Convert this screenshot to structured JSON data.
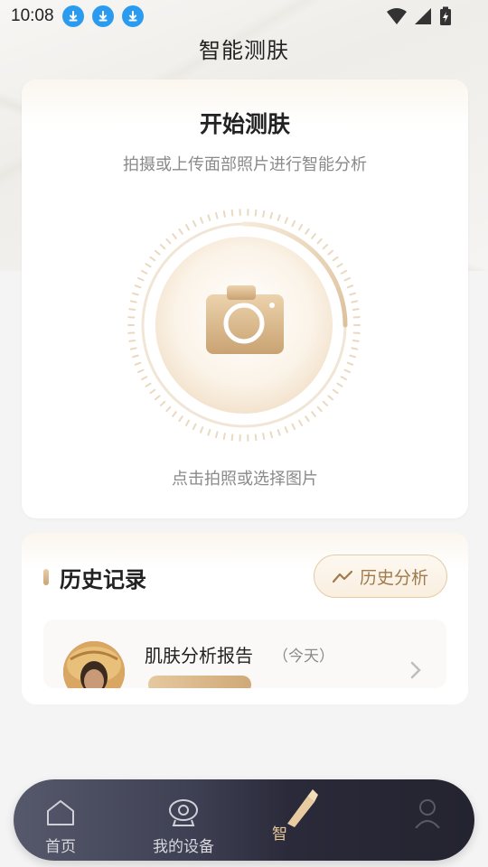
{
  "status_bar": {
    "time": "10:08",
    "download_icon_count": 3,
    "icons": [
      "download-icon",
      "download-icon",
      "download-icon",
      "wifi-icon",
      "cellular-signal-icon",
      "battery-charging-icon"
    ]
  },
  "header": {
    "title": "智能测肤"
  },
  "scan_card": {
    "heading": "开始测肤",
    "subtitle": "拍摄或上传面部照片进行智能分析",
    "camera_icon": "camera-icon",
    "hint": "点击拍照或选择图片"
  },
  "history": {
    "title": "历史记录",
    "analysis_button": "历史分析",
    "analysis_icon": "trend-line-icon",
    "items": [
      {
        "title": "肌肤分析报告",
        "date": "（今天）"
      }
    ]
  },
  "bottom_nav": {
    "items": [
      {
        "label": "首页",
        "icon": "home-icon"
      },
      {
        "label": "我的设备",
        "icon": "device-icon"
      },
      {
        "label": "智",
        "icon": "beauty-pen-icon"
      },
      {
        "label": "",
        "icon": "profile-icon"
      }
    ],
    "active_index": 2
  },
  "colors": {
    "accent_gold": "#c9a476",
    "download_blue": "#2b9bf0",
    "nav_active": "#e5c79a"
  }
}
